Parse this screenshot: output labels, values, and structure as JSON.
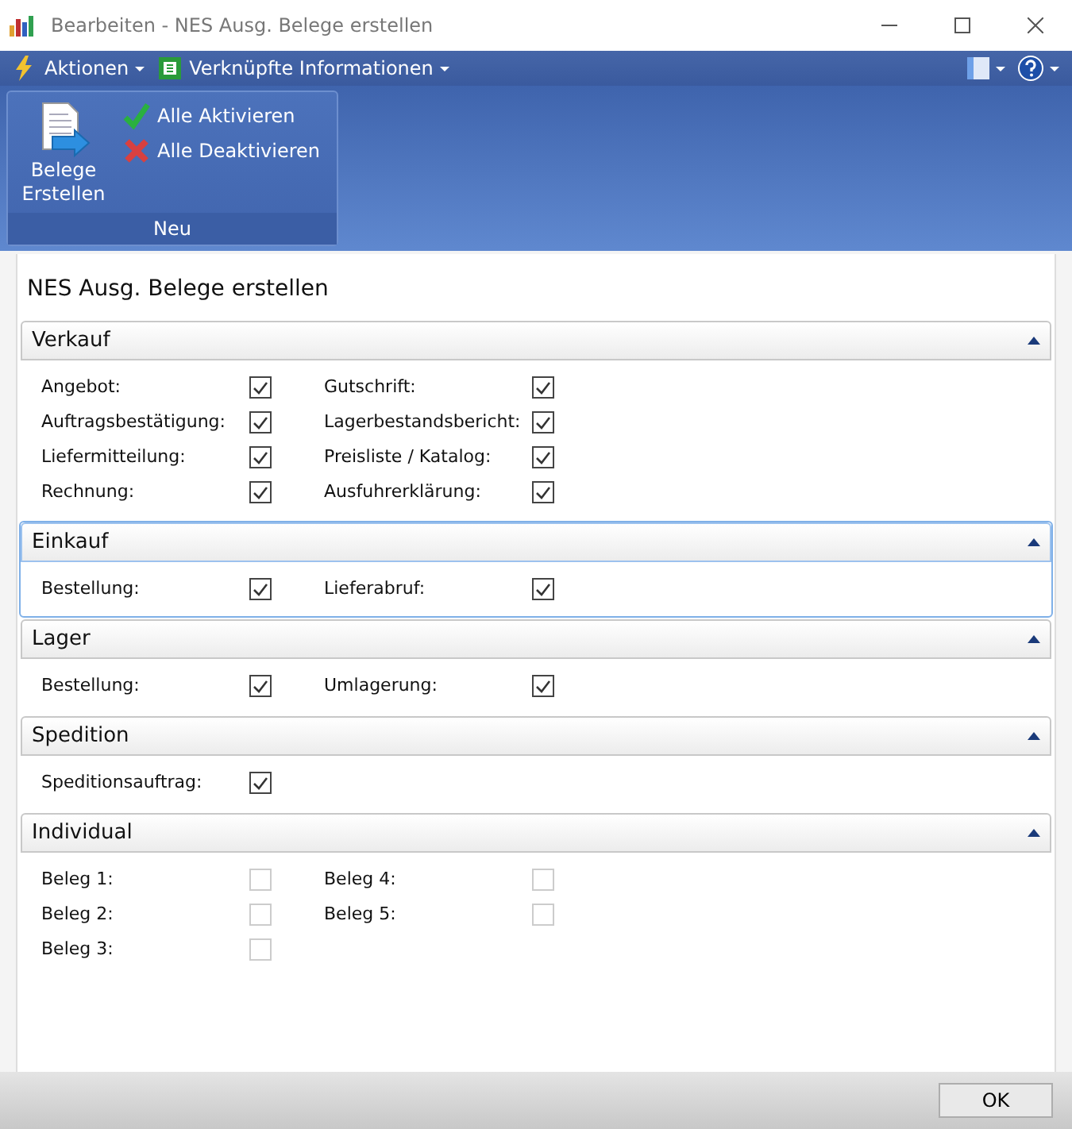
{
  "window": {
    "title": "Bearbeiten - NES Ausg. Belege erstellen"
  },
  "menu_bar": {
    "items": [
      {
        "label": "Aktionen",
        "kind": "lightning"
      },
      {
        "label": "Verknüpfte Informationen",
        "kind": "grid"
      }
    ]
  },
  "ribbon": {
    "groups": [
      {
        "label": "Neu",
        "large_button": {
          "label_lines": [
            "Belege",
            "Erstellen"
          ]
        },
        "small_buttons": [
          {
            "label": "Alle Aktivieren",
            "kind": "check"
          },
          {
            "label": "Alle Deaktivieren",
            "kind": "cross"
          }
        ]
      }
    ]
  },
  "page_title": "NES Ausg. Belege erstellen",
  "sections": [
    {
      "title": "Verkauf",
      "expanded": true,
      "focused": false,
      "columns": [
        [
          {
            "label": "Angebot:",
            "checked": true,
            "disabled": false
          },
          {
            "label": "Auftragsbestätigung:",
            "checked": true,
            "disabled": false
          },
          {
            "label": "Liefermitteilung:",
            "checked": true,
            "disabled": false
          },
          {
            "label": "Rechnung:",
            "checked": true,
            "disabled": false
          }
        ],
        [
          {
            "label": "Gutschrift:",
            "checked": true,
            "disabled": false
          },
          {
            "label": "Lagerbestandsbericht:",
            "checked": true,
            "disabled": false
          },
          {
            "label": "Preisliste / Katalog:",
            "checked": true,
            "disabled": false
          },
          {
            "label": "Ausfuhrerklärung:",
            "checked": true,
            "disabled": false
          }
        ]
      ]
    },
    {
      "title": "Einkauf",
      "expanded": true,
      "focused": true,
      "columns": [
        [
          {
            "label": "Bestellung:",
            "checked": true,
            "disabled": false
          }
        ],
        [
          {
            "label": "Lieferabruf:",
            "checked": true,
            "disabled": false
          }
        ]
      ]
    },
    {
      "title": "Lager",
      "expanded": true,
      "focused": false,
      "columns": [
        [
          {
            "label": "Bestellung:",
            "checked": true,
            "disabled": false
          }
        ],
        [
          {
            "label": "Umlagerung:",
            "checked": true,
            "disabled": false
          }
        ]
      ]
    },
    {
      "title": "Spedition",
      "expanded": true,
      "focused": false,
      "columns": [
        [
          {
            "label": "Speditionsauftrag:",
            "checked": true,
            "disabled": false
          }
        ],
        []
      ]
    },
    {
      "title": "Individual",
      "expanded": true,
      "focused": false,
      "columns": [
        [
          {
            "label": "Beleg 1:",
            "checked": false,
            "disabled": true
          },
          {
            "label": "Beleg 2:",
            "checked": false,
            "disabled": true
          },
          {
            "label": "Beleg 3:",
            "checked": false,
            "disabled": true
          }
        ],
        [
          {
            "label": "Beleg 4:",
            "checked": false,
            "disabled": true
          },
          {
            "label": "Beleg 5:",
            "checked": false,
            "disabled": true
          }
        ]
      ]
    }
  ],
  "footer": {
    "buttons": [
      "OK"
    ]
  }
}
